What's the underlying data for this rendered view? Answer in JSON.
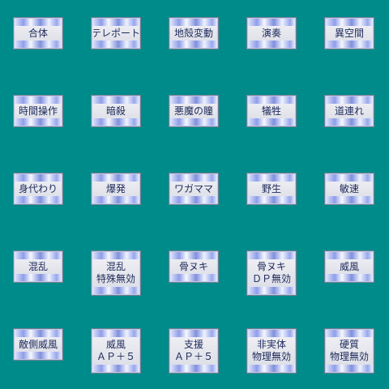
{
  "background_color": "#008b8b",
  "tiles": [
    {
      "lines": [
        "合体"
      ]
    },
    {
      "lines": [
        "テレポート"
      ]
    },
    {
      "lines": [
        "地殻変動"
      ]
    },
    {
      "lines": [
        "演奏"
      ]
    },
    {
      "lines": [
        "異空間"
      ]
    },
    {
      "lines": [
        "時間操作"
      ]
    },
    {
      "lines": [
        "暗殺"
      ]
    },
    {
      "lines": [
        "悪魔の瞳"
      ]
    },
    {
      "lines": [
        "犠牲"
      ]
    },
    {
      "lines": [
        "道連れ"
      ]
    },
    {
      "lines": [
        "身代わり"
      ]
    },
    {
      "lines": [
        "爆発"
      ]
    },
    {
      "lines": [
        "ワガママ"
      ]
    },
    {
      "lines": [
        "野生"
      ]
    },
    {
      "lines": [
        "敏速"
      ]
    },
    {
      "lines": [
        "混乱"
      ]
    },
    {
      "lines": [
        "混乱",
        "特殊無効"
      ]
    },
    {
      "lines": [
        "骨ヌキ"
      ]
    },
    {
      "lines": [
        "骨ヌキ",
        "ＤＰ無効"
      ]
    },
    {
      "lines": [
        "威風"
      ]
    },
    {
      "lines": [
        "敵側威風"
      ]
    },
    {
      "lines": [
        "威風",
        "ＡＰ＋５"
      ]
    },
    {
      "lines": [
        "支援",
        "ＡＰ＋５"
      ]
    },
    {
      "lines": [
        "非実体",
        "物理無効"
      ]
    },
    {
      "lines": [
        "硬質",
        "物理無効"
      ]
    }
  ]
}
